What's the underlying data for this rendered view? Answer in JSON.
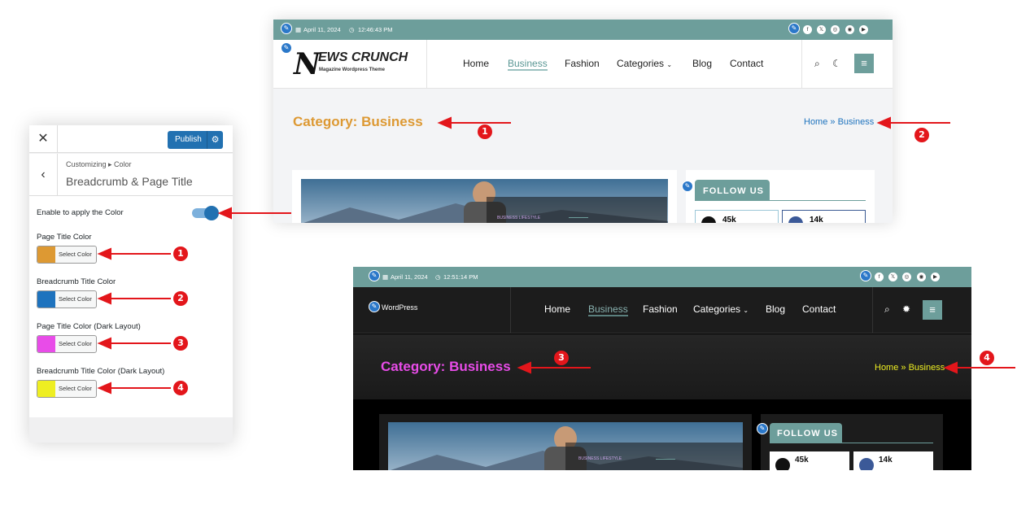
{
  "customizer": {
    "publish_label": "Publish",
    "breadcrumb": "Customizing ▸ Color",
    "title": "Breadcrumb & Page Title",
    "toggle_label": "Enable to apply the Color",
    "toggle_on": true,
    "fields": [
      {
        "label": "Page Title Color",
        "button": "Select Color",
        "color": "#dd9933",
        "marker": "1"
      },
      {
        "label": "Breadcrumb Title Color",
        "button": "Select Color",
        "color": "#1e73be",
        "marker": "2"
      },
      {
        "label": "Page Title Color (Dark Layout)",
        "button": "Select Color",
        "color": "#e84ce8",
        "marker": "3"
      },
      {
        "label": "Breadcrumb Title Color (Dark Layout)",
        "button": "Select Color",
        "color": "#eeee22",
        "marker": "4"
      }
    ]
  },
  "light_preview": {
    "date": "April 11, 2024",
    "time": "12:46:43 PM",
    "logo_main": "EWS CRUNCH",
    "logo_tagline": "Magazine Wordpress Theme",
    "nav": [
      "Home",
      "Business",
      "Fashion",
      "Categories",
      "Blog",
      "Contact"
    ],
    "active_nav": "Business",
    "page_title": "Category: Business",
    "breadcrumb": "Home » Business",
    "follow_us": "FOLLOW US",
    "follower_counts": [
      "45k",
      "14k"
    ],
    "post_category": "BUSINESS LIFESTYLE",
    "markers": [
      "1",
      "2"
    ]
  },
  "dark_preview": {
    "date": "April 11, 2024",
    "time": "12:51:14 PM",
    "logo_alt": "WordPress",
    "nav": [
      "Home",
      "Business",
      "Fashion",
      "Categories",
      "Blog",
      "Contact"
    ],
    "active_nav": "Business",
    "page_title": "Category: Business",
    "breadcrumb": "Home » Business",
    "follow_us": "FOLLOW US",
    "follower_counts": [
      "45k",
      "14k"
    ],
    "post_category": "BUSINESS LIFESTYLE",
    "markers": [
      "3",
      "4"
    ]
  },
  "colors": {
    "accent": "#2271b1",
    "topbar": "#6d9e9b",
    "arrow": "#e3161b"
  }
}
